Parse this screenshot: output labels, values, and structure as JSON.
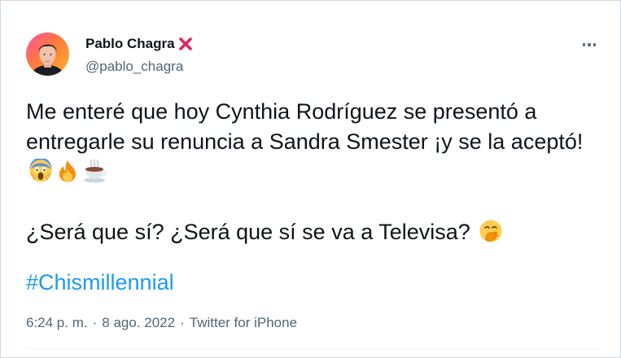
{
  "author": {
    "display_name": "Pablo Chagra",
    "name_emoji": "cross-mark-icon",
    "handle": "@pablo_chagra"
  },
  "menu": {
    "icon": "more-options-icon"
  },
  "tweet": {
    "line1": "Me enteré que hoy Cynthia Rodríguez se presentó a entregarle su renuncia a Sandra Smester ¡y se la aceptó!",
    "line1_emojis": [
      "screaming-face-icon",
      "fire-icon",
      "hot-beverage-icon"
    ],
    "line2": "¿Será que sí? ¿Será que sí se va a Televisa?",
    "line2_emoji": "face-with-hand-over-mouth-icon",
    "hashtag": "#Chismillennial"
  },
  "meta": {
    "time": "6:24 p. m.",
    "separator": "·",
    "date": "8 ago. 2022",
    "source": "Twitter for iPhone"
  },
  "colors": {
    "text": "#0f1419",
    "secondary": "#536471",
    "link": "#1d9bf0",
    "border": "#cfd9de",
    "x_mark": "#e0245e"
  }
}
